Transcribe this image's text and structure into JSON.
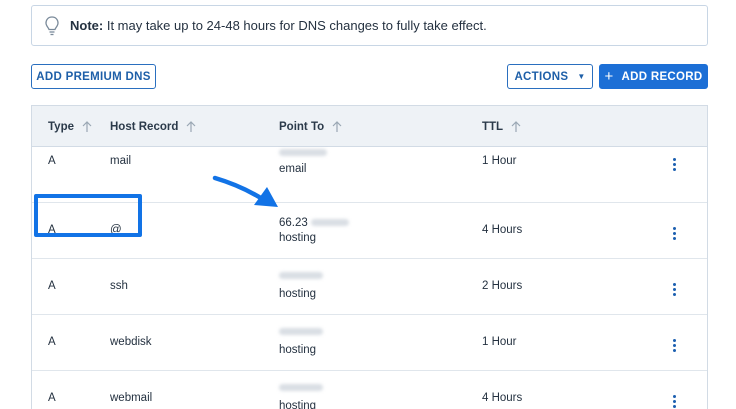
{
  "note": {
    "label": "Note:",
    "text": " It may take up to 24-48 hours for DNS changes to fully take effect."
  },
  "toolbar": {
    "premium_label": "ADD PREMIUM DNS",
    "actions_label": "ACTIONS",
    "add_label": "ADD RECORD"
  },
  "table": {
    "headers": [
      "Type",
      "Host Record",
      "Point To",
      "TTL"
    ],
    "rows": [
      {
        "type": "A",
        "host": "mail",
        "point_visible": "",
        "point_sub": "email",
        "ttl": "1 Hour"
      },
      {
        "type": "A",
        "host": "@",
        "point_visible": "66.23",
        "point_sub": "hosting",
        "ttl": "4 Hours"
      },
      {
        "type": "A",
        "host": "ssh",
        "point_visible": "",
        "point_sub": "hosting",
        "ttl": "2 Hours"
      },
      {
        "type": "A",
        "host": "webdisk",
        "point_visible": "",
        "point_sub": "hosting",
        "ttl": "1 Hour"
      },
      {
        "type": "A",
        "host": "webmail",
        "point_visible": "",
        "point_sub": "hosting",
        "ttl": "4 Hours"
      }
    ]
  },
  "colors": {
    "accent": "#1c6fd6",
    "highlight": "#1273e6",
    "header_bg": "#eef2f6"
  },
  "icons": {
    "note": "lightbulb-icon",
    "sort": "arrow-up-icon",
    "row_menu": "kebab-menu-icon",
    "actions_caret": "caret-down-icon",
    "add": "plus-icon"
  }
}
